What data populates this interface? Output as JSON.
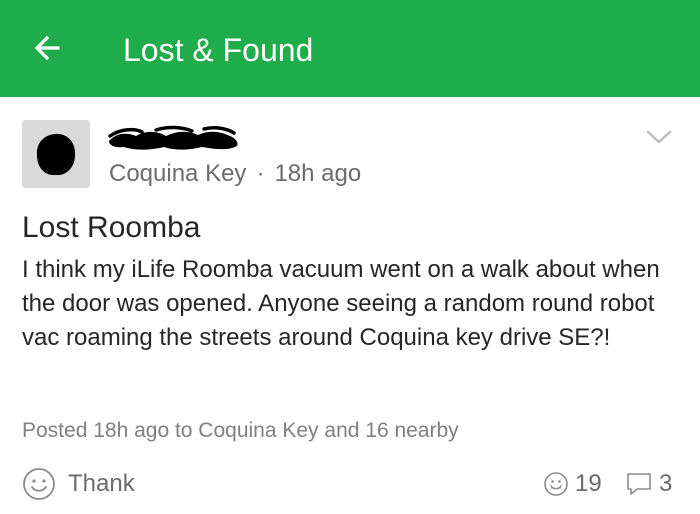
{
  "appbar": {
    "title": "Lost & Found",
    "color": "#1fad4b",
    "back_icon": "arrow-left-icon"
  },
  "post": {
    "author": "",
    "neighborhood": "Coquina Key",
    "separator": "·",
    "time": "18h ago",
    "title": "Lost Roomba",
    "body": "I think my iLife Roomba vacuum went on a walk about when the door was opened.  Anyone seeing a random round robot vac roaming the streets around Coquina key drive SE?!",
    "posted_info": "Posted 18h ago to Coquina Key and 16 nearby"
  },
  "actions": {
    "thank_label": "Thank",
    "thanks_count": "19",
    "replies_count": "3"
  }
}
